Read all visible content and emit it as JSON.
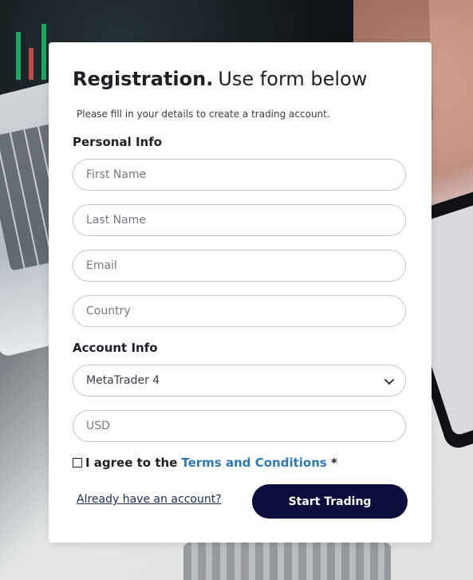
{
  "form": {
    "title_bold": "Registration.",
    "title_light": "Use form below",
    "subtitle": "Please fill in your details to create a trading account.",
    "sections": {
      "personal": "Personal Info",
      "account": "Account Info"
    },
    "fields": {
      "first_name": {
        "placeholder": "First Name"
      },
      "last_name": {
        "placeholder": "Last Name"
      },
      "email": {
        "placeholder": "Email"
      },
      "country": {
        "placeholder": "Country"
      },
      "platform": {
        "selected": "MetaTrader 4"
      },
      "currency": {
        "placeholder": "USD"
      }
    },
    "agree": {
      "prefix": "I agree to the",
      "link": "Terms and Conditions",
      "required_mark": "*"
    },
    "login_link": "Already have an account?",
    "submit_label": "Start Trading"
  },
  "colors": {
    "accent_link": "#2f79b6",
    "button_bg": "#0b0e3d",
    "card_bg": "#ffffff"
  },
  "icons": {
    "select": "chevron-down-icon",
    "checkbox": "checkbox-icon"
  }
}
